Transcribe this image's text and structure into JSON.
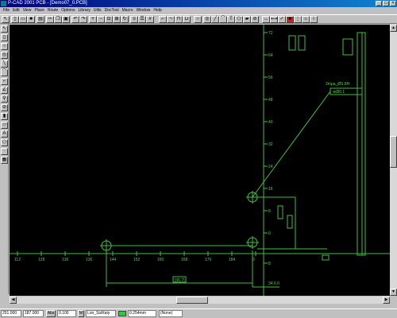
{
  "window": {
    "title": "P-CAD 2001 PCB - [Demo07_0.PCB]",
    "controls": [
      "_",
      "□",
      "×"
    ]
  },
  "menu": [
    "File",
    "Edit",
    "View",
    "Place",
    "Route",
    "Options",
    "Library",
    "Utils",
    "DocTool",
    "Macro",
    "Window",
    "Help"
  ],
  "status": {
    "x_coord": "251.000",
    "y_coord": "187.000",
    "abs_label": "Abs",
    "grid_value": "0.100",
    "m_label": "M",
    "layer": "Lon_SizRaty",
    "width": "0.254mm",
    "net": "(None)"
  },
  "canvas": {
    "x_ticks": [
      "112",
      "128",
      "136",
      "136",
      "144",
      "152",
      "160",
      "168",
      "176",
      "184",
      "0"
    ],
    "y_ticks": [
      "72",
      "64",
      "56",
      "48",
      "40",
      "32",
      "24",
      "16",
      "8",
      "0",
      "8"
    ],
    "dim_label_bottom": "[36.7]",
    "dim_label_right": "34.6.0",
    "callout_text": "2mpa_ØS.8H",
    "callout_box": "⊕Ø0.1"
  },
  "colors": {
    "canvas_bg": "#000000",
    "cad_green": "#3ec03e",
    "titlebar": "#000080"
  }
}
